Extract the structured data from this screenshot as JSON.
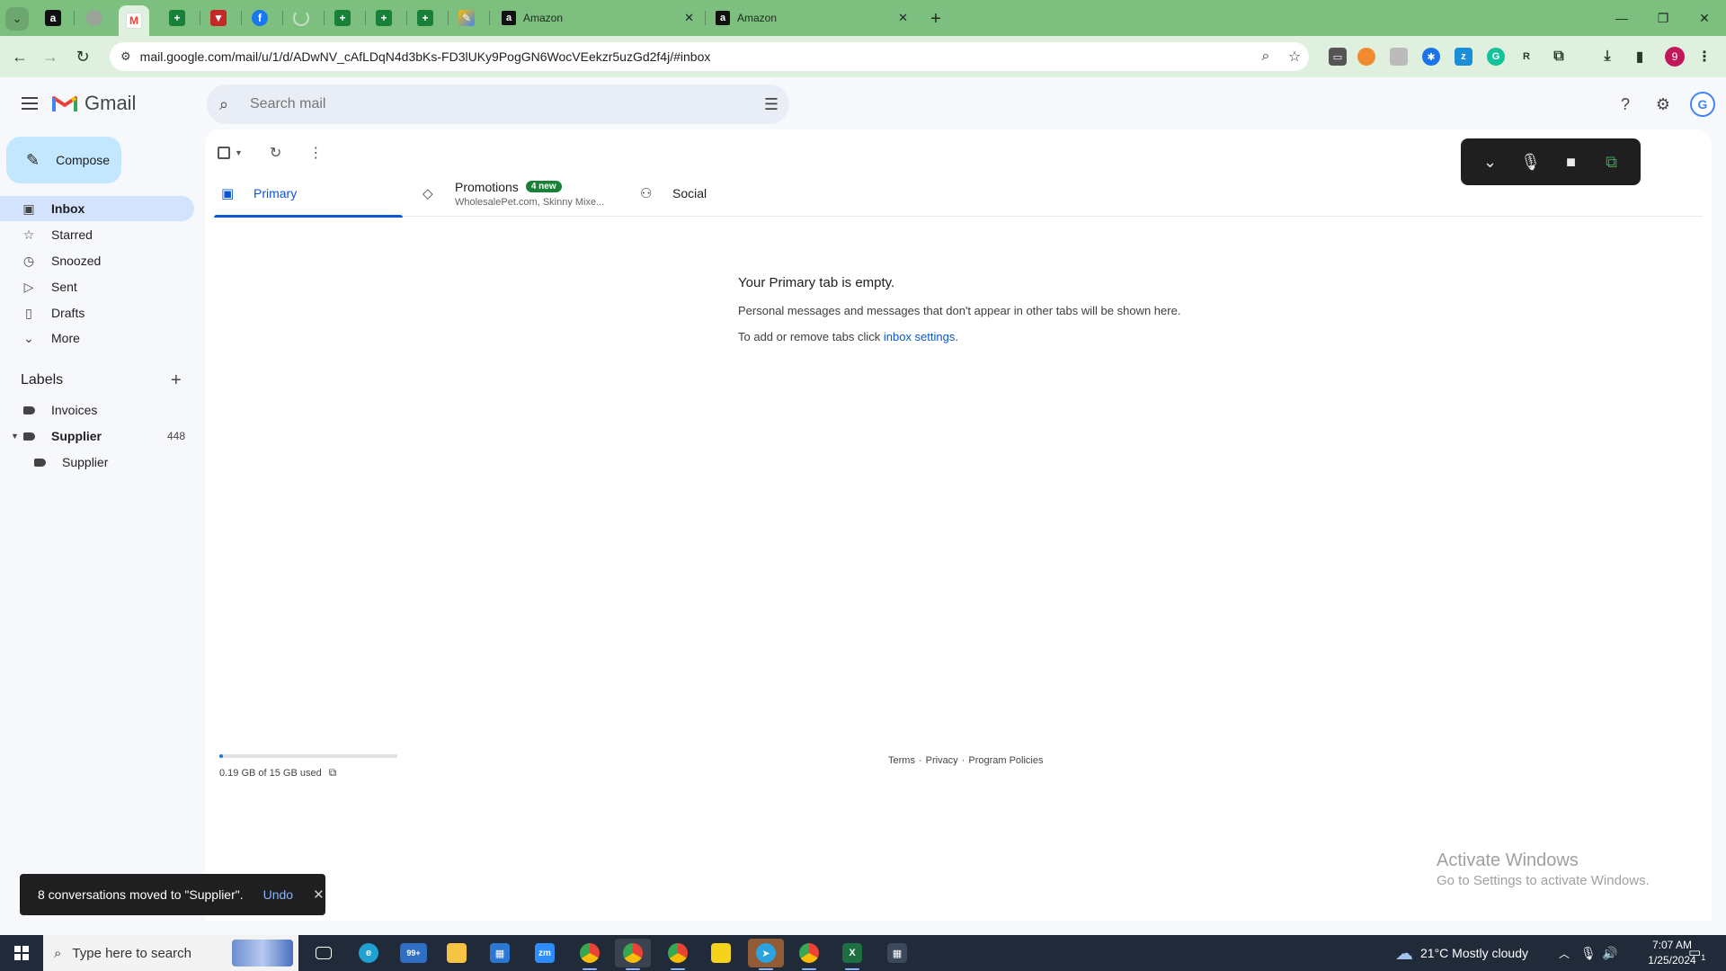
{
  "browser": {
    "tabs": [
      {
        "title": "Amazon"
      },
      {
        "title": "Amazon"
      }
    ],
    "url": "mail.google.com/mail/u/1/d/ADwNV_cAfLDqN4d3bKs-FD3lUKy9PogGN6WocVEekzr5uzGd2f4j/#inbox",
    "profile_initial": "9"
  },
  "gmail": {
    "logo_text": "Gmail",
    "search_placeholder": "Search mail",
    "compose_label": "Compose",
    "nav": [
      {
        "label": "Inbox",
        "icon": "inbox-icon",
        "active": true
      },
      {
        "label": "Starred",
        "icon": "star-icon"
      },
      {
        "label": "Snoozed",
        "icon": "clock-icon"
      },
      {
        "label": "Sent",
        "icon": "send-icon"
      },
      {
        "label": "Drafts",
        "icon": "draft-icon"
      },
      {
        "label": "More",
        "icon": "chevron-down-icon"
      }
    ],
    "labels_heading": "Labels",
    "labels": [
      {
        "label": "Invoices",
        "count": ""
      },
      {
        "label": "Supplier",
        "count": "448"
      },
      {
        "label": "Supplier",
        "count": ""
      }
    ],
    "tabs": {
      "primary": "Primary",
      "promotions": "Promotions",
      "promotions_badge": "4 new",
      "promotions_senders": "WholesalePet.com, Skinny Mixe...",
      "social": "Social"
    },
    "empty_state": {
      "title": "Your Primary tab is empty.",
      "line1": "Personal messages and messages that don't appear in other tabs will be shown here.",
      "line2_prefix": "To add or remove tabs click ",
      "line2_link": "inbox settings",
      "line2_suffix": "."
    },
    "storage": {
      "text": "0.19 GB of 15 GB used",
      "used_fraction": 0.013
    },
    "footer": {
      "terms": "Terms",
      "privacy": "Privacy",
      "policies": "Program Policies",
      "sep": "·"
    },
    "snackbar": {
      "text": "8 conversations moved to \"Supplier\".",
      "undo": "Undo"
    },
    "avatar_letter": "G"
  },
  "watermark": {
    "line1": "Activate Windows",
    "line2": "Go to Settings to activate Windows."
  },
  "taskbar": {
    "search_placeholder": "Type here to search",
    "weather": "21°C  Mostly cloudy",
    "time": "7:07 AM",
    "date": "1/25/2024",
    "mail_badge": "99+",
    "notification_count": "1"
  },
  "colors": {
    "tabstrip": "#7cbf7f",
    "toolbar": "#dff0df",
    "compose": "#c2e7ff",
    "nav_active": "#d3e3fd",
    "accent": "#0b57d0",
    "badge": "#188038"
  }
}
